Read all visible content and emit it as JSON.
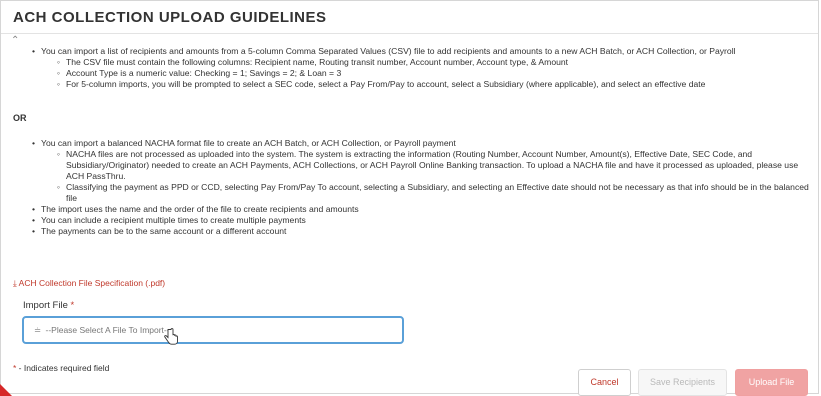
{
  "page": {
    "title": "ACH COLLECTION UPLOAD GUIDELINES",
    "collapse_icon": "chevron-up-icon"
  },
  "guidelines": {
    "csv": {
      "main": "You can import a list of recipients and amounts from a 5-column Comma Separated Values (CSV) file to add recipients and amounts to a new ACH Batch, or ACH Collection, or Payroll",
      "subs": [
        "The CSV file must contain the following columns: Recipient name, Routing transit number, Account number, Account type, & Amount",
        "Account Type is a numeric value: Checking = 1; Savings = 2; & Loan = 3",
        "For 5-column imports, you will be prompted to select a SEC code, select a Pay From/Pay to account, select a Subsidiary (where applicable), and select an effective date"
      ]
    },
    "or_label": "OR",
    "nacha": {
      "main": "You can import a balanced NACHA format file to create an ACH Batch, or ACH Collection, or Payroll payment",
      "subs": [
        "NACHA files are not processed as uploaded into the system. The system is extracting the information (Routing Number, Account Number, Amount(s), Effective Date, SEC Code, and Subsidiary/Originator) needed to create an ACH Payments, ACH Collections, or ACH Payroll Online Banking transaction. To upload a NACHA file and have it processed as uploaded, please use ACH PassThru.",
        "Classifying the payment as PPD or CCD, selecting Pay From/Pay To account, selecting a Subsidiary, and selecting an Effective date should not be necessary as that info should be in the balanced file"
      ]
    },
    "more": [
      "The import uses the name and the order of the file to create recipients and amounts",
      "You can include a recipient multiple times to create multiple payments",
      "The payments can be to the same account or a different account"
    ]
  },
  "pdf_link": {
    "icon": "download-icon",
    "label": "ACH Collection File Specification (.pdf)"
  },
  "import_file": {
    "label": "Import File",
    "required_mark": "*",
    "placeholder": "--Please Select A File To Import--",
    "icon": "paperclip-icon"
  },
  "required_note": {
    "mark": "*",
    "text": " - Indicates required field"
  },
  "buttons": {
    "cancel": "Cancel",
    "save": "Save Recipients",
    "upload": "Upload File"
  },
  "colors": {
    "accent_red": "#c0392b",
    "upload_disabled": "#f0a3a3",
    "focus_border": "#5aa0d8"
  }
}
